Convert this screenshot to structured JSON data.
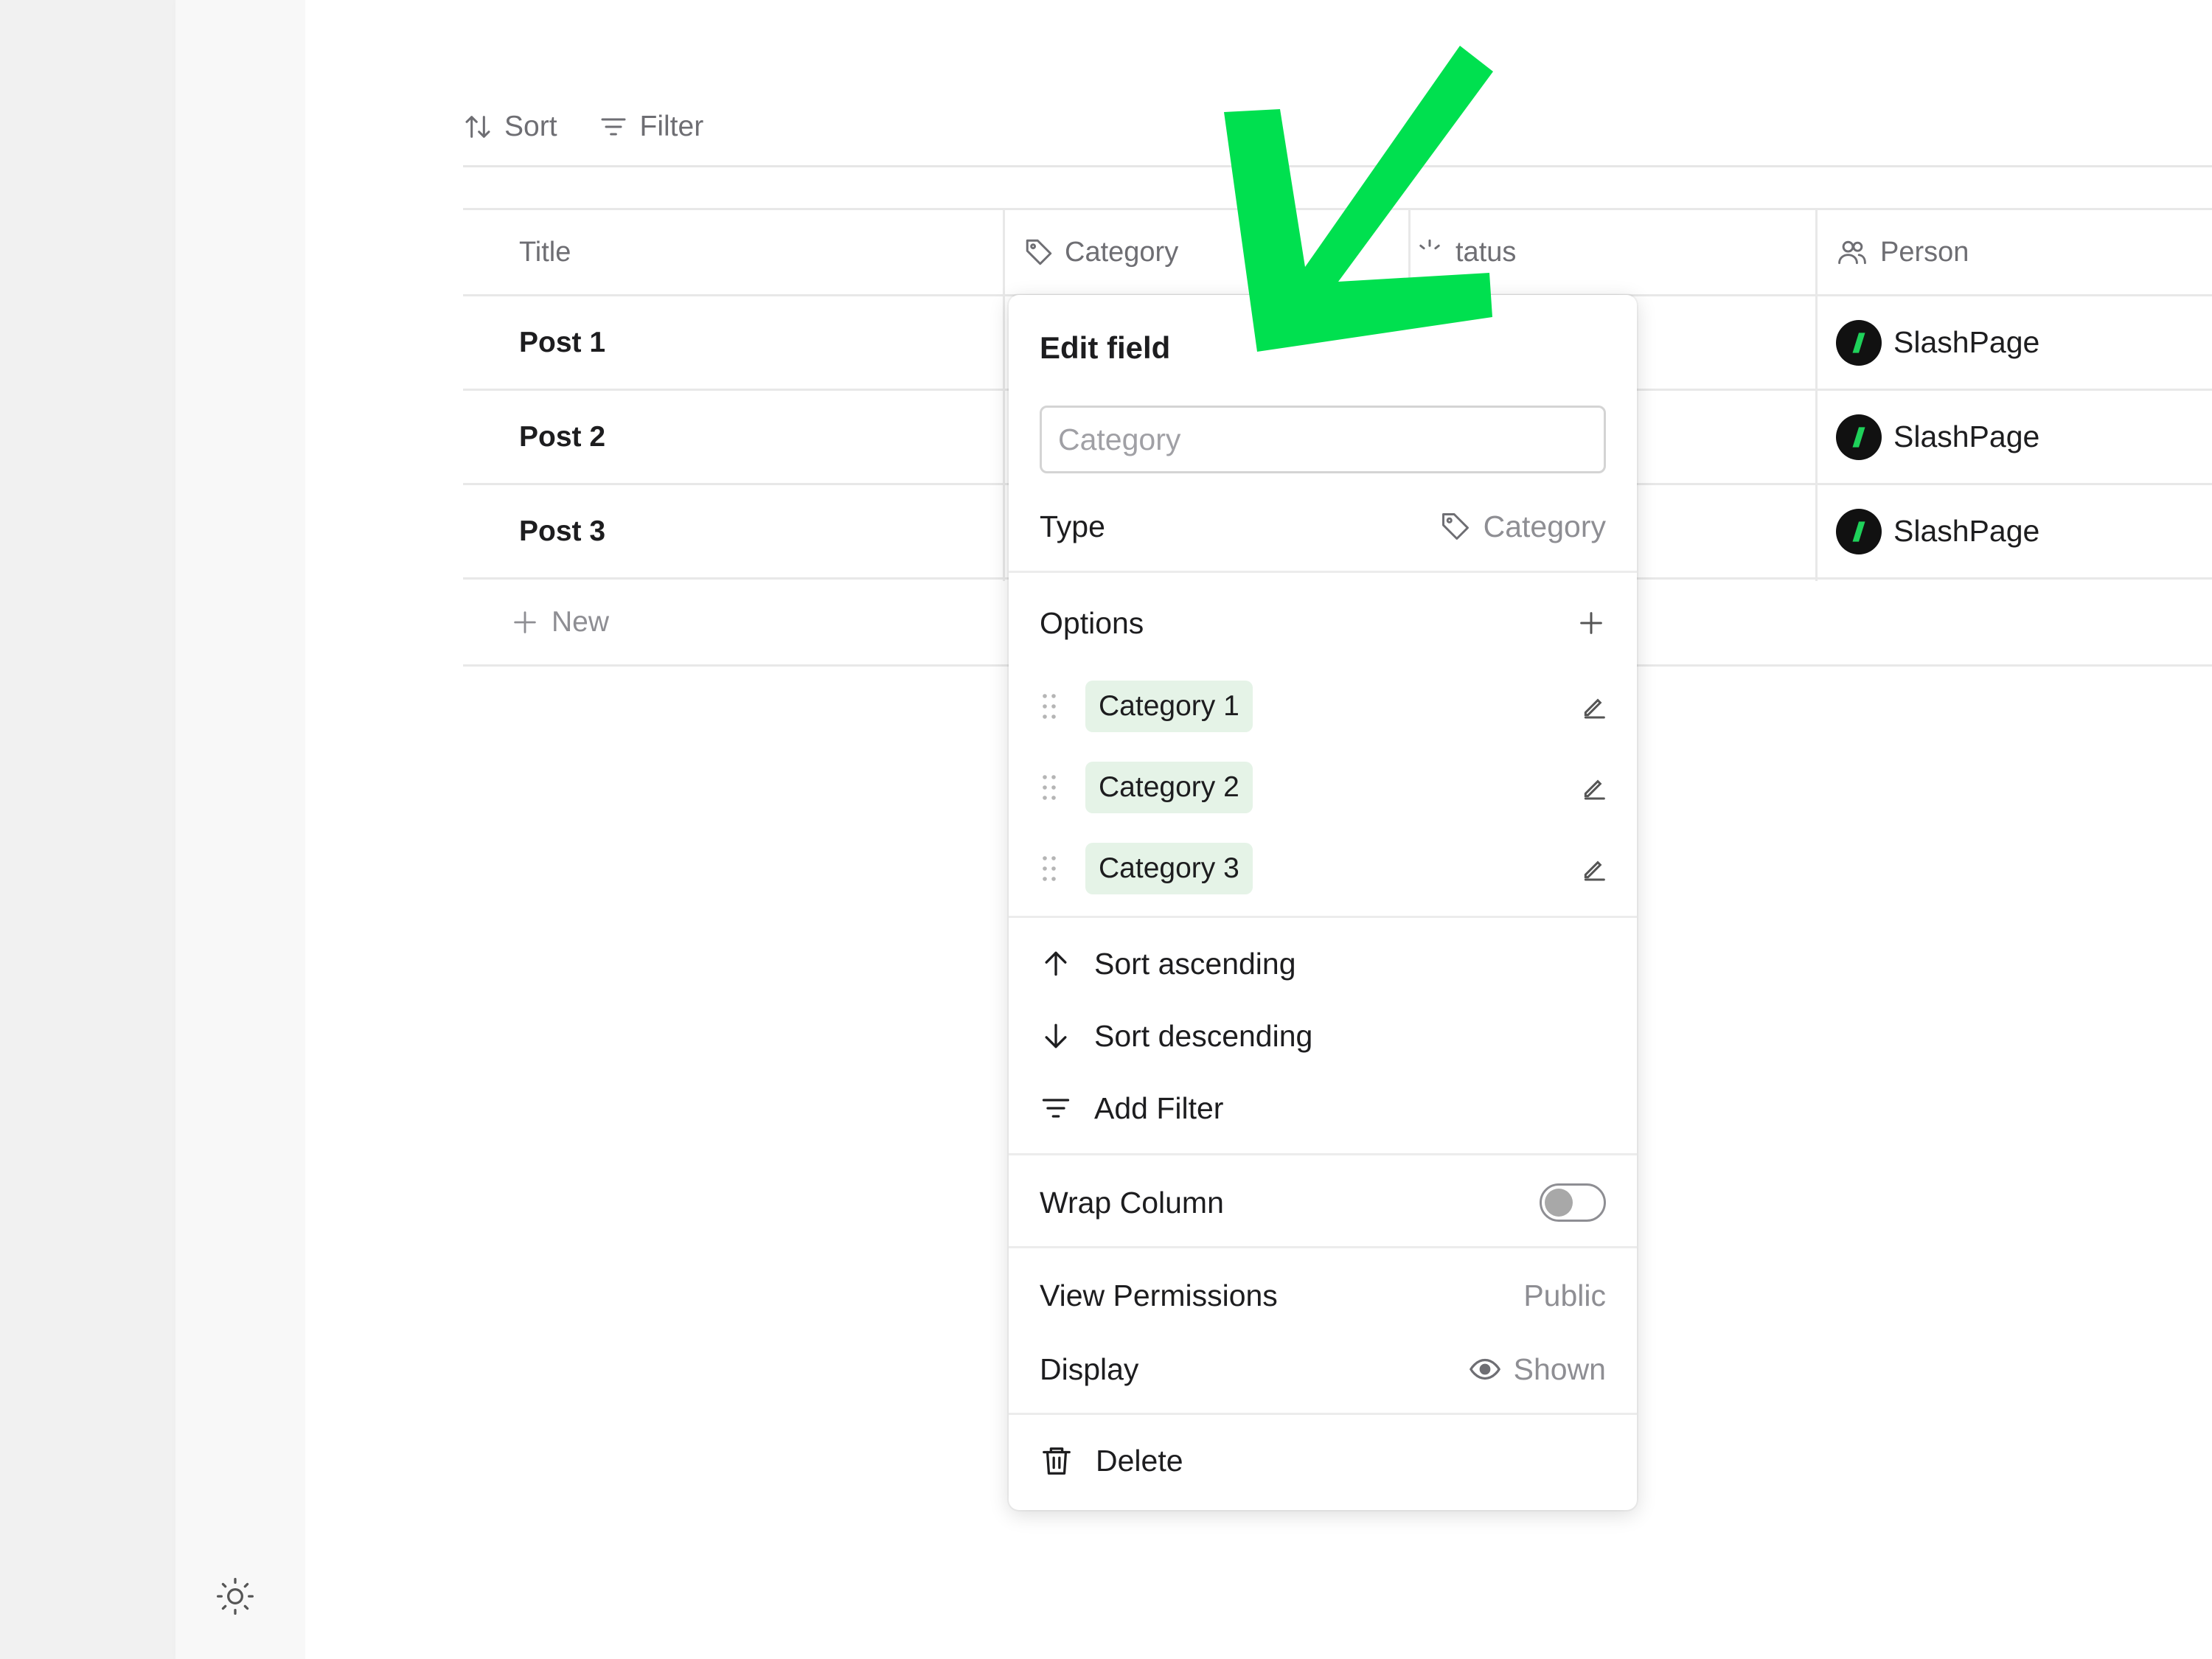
{
  "toolbar": {
    "sort_label": "Sort",
    "filter_label": "Filter"
  },
  "table": {
    "headers": {
      "title": "Title",
      "category": "Category",
      "status": "tatus",
      "person": "Person"
    },
    "rows": [
      {
        "title": "Post 1",
        "person": "SlashPage"
      },
      {
        "title": "Post 2",
        "person": "SlashPage"
      },
      {
        "title": "Post 3",
        "person": "SlashPage"
      }
    ],
    "new_label": "New"
  },
  "popover": {
    "title": "Edit field",
    "name_placeholder": "Category",
    "type_label": "Type",
    "type_value": "Category",
    "options_label": "Options",
    "options": [
      "Category 1",
      "Category 2",
      "Category 3"
    ],
    "sort_asc": "Sort ascending",
    "sort_desc": "Sort descending",
    "add_filter": "Add Filter",
    "wrap_column": "Wrap Column",
    "wrap_enabled": false,
    "view_permissions_label": "View Permissions",
    "view_permissions_value": "Public",
    "display_label": "Display",
    "display_value": "Shown",
    "delete_label": "Delete"
  },
  "colors": {
    "accent_green": "#00e04f",
    "chip_bg": "#e5f3e7",
    "avatar_bg": "#111111"
  },
  "icons": [
    "sun-icon",
    "sort-icon",
    "filter-icon",
    "tag-icon",
    "status-icon",
    "people-icon",
    "plus-icon",
    "drag-handle-icon",
    "pencil-icon",
    "arrow-up-icon",
    "arrow-down-icon",
    "trash-icon",
    "eye-icon",
    "slashpage-logo-icon",
    "annotation-arrow-icon"
  ]
}
